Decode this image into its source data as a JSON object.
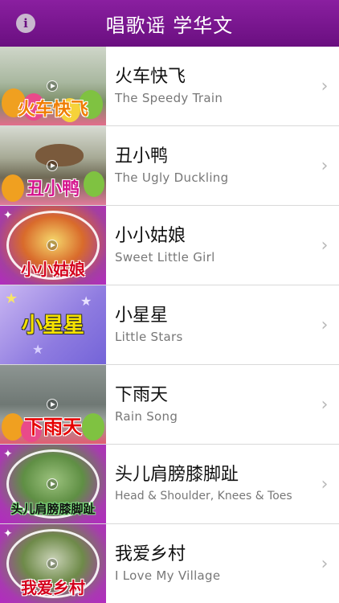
{
  "header": {
    "title": "唱歌谣 学华文",
    "info_icon": "info-icon"
  },
  "songs": [
    {
      "cn": "火车快飞",
      "en": "The Speedy Train",
      "thumb_caption": "火车快飞"
    },
    {
      "cn": "丑小鸭",
      "en": "The Ugly Duckling",
      "thumb_caption": "丑小鸭"
    },
    {
      "cn": "小小姑娘",
      "en": "Sweet Little Girl",
      "thumb_caption": "小小姑娘"
    },
    {
      "cn": "小星星",
      "en": "Little Stars",
      "thumb_caption": "小星星"
    },
    {
      "cn": "下雨天",
      "en": "Rain Song",
      "thumb_caption": "下雨天"
    },
    {
      "cn": "头儿肩膀膝脚趾",
      "en": "Head & Shoulder, Knees & Toes",
      "thumb_caption": "头儿肩膀膝脚趾"
    },
    {
      "cn": "我爱乡村",
      "en": "I Love My Village",
      "thumb_caption": "我爱乡村"
    }
  ],
  "chevron_icon": "chevron-right-icon",
  "colors": {
    "header": "#7a1890",
    "caption": "#e60000",
    "separator": "#d9d9d9"
  }
}
